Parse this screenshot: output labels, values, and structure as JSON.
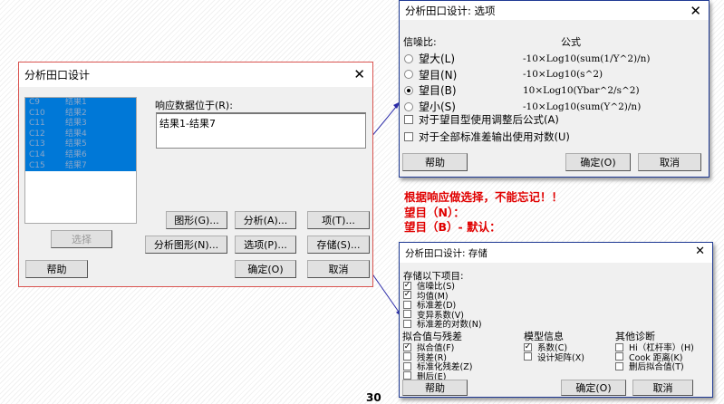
{
  "main_dialog": {
    "title": "分析田口设计",
    "list": [
      {
        "col": "C9",
        "name": "结果1"
      },
      {
        "col": "C10",
        "name": "结果2"
      },
      {
        "col": "C11",
        "name": "结果3"
      },
      {
        "col": "C12",
        "name": "结果4"
      },
      {
        "col": "C13",
        "name": "结果5"
      },
      {
        "col": "C14",
        "name": "结果6"
      },
      {
        "col": "C15",
        "name": "结果7"
      }
    ],
    "response_label": "响应数据位于(R):",
    "response_value": "结果1-结果7",
    "buttons": {
      "graphs": "图形(G)...",
      "analysis": "分析(A)...",
      "terms": "项(T)...",
      "select": "选择",
      "analysis_graphs": "分析图形(N)...",
      "options": "选项(P)...",
      "storage": "存储(S)...",
      "help": "帮助",
      "ok": "确定(O)",
      "cancel": "取消"
    }
  },
  "options_dialog": {
    "title": "分析田口设计: 选项",
    "sn_label": "信噪比:",
    "formula_label": "公式",
    "radios": [
      {
        "label": "望大(L)",
        "formula": "-10×Log10(sum(1/Y^2)/n)",
        "selected": false
      },
      {
        "label": "望目(N)",
        "formula": "-10×Log10(s^2)",
        "selected": false
      },
      {
        "label": "望目(B)",
        "formula": "10×Log10(Ybar^2/s^2)",
        "selected": true
      },
      {
        "label": "望小(S)",
        "formula": "-10×Log10(sum(Y^2)/n)",
        "selected": false
      }
    ],
    "checks": [
      {
        "label": "对于望目型使用调整后公式(A)",
        "checked": false
      },
      {
        "label": "对于全部标准差输出使用对数(U)",
        "checked": false
      }
    ],
    "buttons": {
      "help": "帮助",
      "ok": "确定(O)",
      "cancel": "取消"
    }
  },
  "annotation": {
    "line1": "根据响应做选择，不能忘记！！",
    "line2": "望目（N）：",
    "line3": "望目（B）- 默认："
  },
  "storage_dialog": {
    "title": "分析田口设计: 存储",
    "store_label": "存储以下项目:",
    "store_items": [
      {
        "label": "信噪比(S)",
        "checked": true
      },
      {
        "label": "均值(M)",
        "checked": true
      },
      {
        "label": "标准差(D)",
        "checked": false
      },
      {
        "label": "变异系数(V)",
        "checked": false
      },
      {
        "label": "标准差的对数(N)",
        "checked": false
      }
    ],
    "fits_label": "拟合值与残差",
    "fits_items": [
      {
        "label": "拟合值(F)",
        "checked": true
      },
      {
        "label": "残差(R)",
        "checked": false
      },
      {
        "label": "标准化残差(Z)",
        "checked": false
      },
      {
        "label": "删后(E)",
        "checked": false
      }
    ],
    "model_label": "模型信息",
    "model_items": [
      {
        "label": "系数(C)",
        "checked": true
      },
      {
        "label": "设计矩阵(X)",
        "checked": false
      }
    ],
    "diag_label": "其他诊断",
    "diag_items": [
      {
        "label": "Hi（杠杆率）(H)",
        "checked": false
      },
      {
        "label": "Cook 距离(K)",
        "checked": false
      },
      {
        "label": "删后拟合值(T)",
        "checked": false
      }
    ],
    "buttons": {
      "help": "帮助",
      "ok": "确定(O)",
      "cancel": "取消"
    }
  },
  "page_number": "30"
}
